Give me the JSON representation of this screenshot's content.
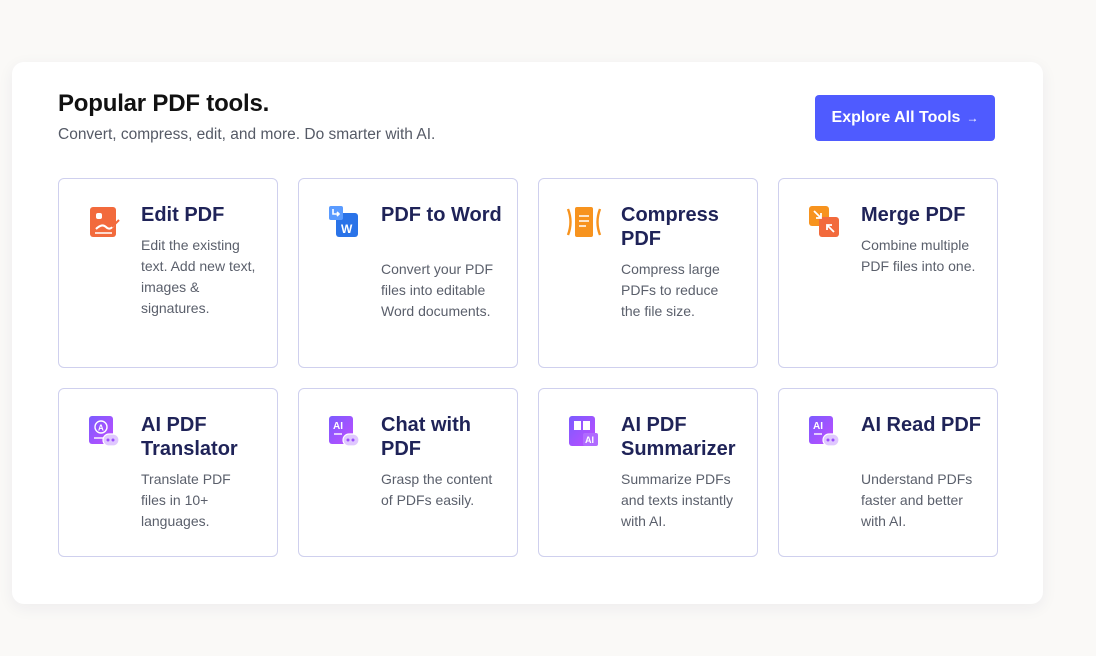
{
  "header": {
    "title": "Popular PDF tools.",
    "subtitle": "Convert, compress, edit, and more. Do smarter with AI.",
    "explore_label": "Explore All Tools",
    "explore_arrow": "→"
  },
  "colors": {
    "accent": "#4f5bff",
    "card_border": "#cfd0ee",
    "title": "#1f2358",
    "orange": "#f26a3c",
    "blue": "#2a73e8",
    "purple": "#9b4dff"
  },
  "tools": [
    {
      "title": "Edit PDF",
      "description": "Edit the existing text. Add new text, images & signatures.",
      "icon": "edit-pdf-icon"
    },
    {
      "title": "PDF to Word",
      "description": "Convert your PDF files into editable Word documents.",
      "icon": "word-icon"
    },
    {
      "title": "Compress PDF",
      "description": "Compress large PDFs to reduce the file size.",
      "icon": "compress-icon"
    },
    {
      "title": "Merge PDF",
      "description": "Combine multiple PDF files into one.",
      "icon": "merge-icon"
    },
    {
      "title": "AI PDF Translator",
      "description": "Translate PDF files in 10+ languages.",
      "icon": "ai-translator-icon"
    },
    {
      "title": "Chat with PDF",
      "description": "Grasp the content of PDFs easily.",
      "icon": "ai-chat-icon"
    },
    {
      "title": "AI PDF Summarizer",
      "description": "Summarize PDFs and texts instantly with AI.",
      "icon": "ai-summarizer-icon"
    },
    {
      "title": "AI Read PDF",
      "description": "Understand PDFs faster and better with AI.",
      "icon": "ai-read-icon"
    }
  ]
}
